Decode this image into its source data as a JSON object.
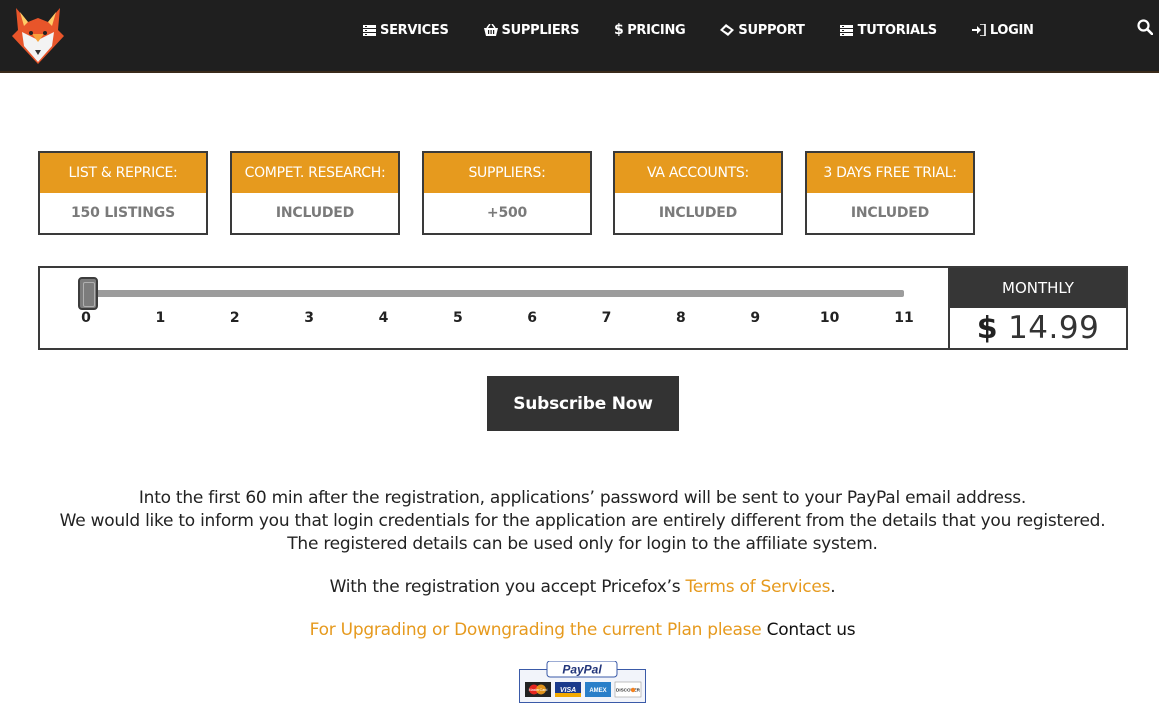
{
  "nav": {
    "items": [
      {
        "label": "SERVICES",
        "icon": "server-icon"
      },
      {
        "label": "SUPPLIERS",
        "icon": "basket-icon"
      },
      {
        "label": "PRICING",
        "icon": "dollar-icon"
      },
      {
        "label": "SUPPORT",
        "icon": "ticket-icon"
      },
      {
        "label": "TUTORIALS",
        "icon": "server-icon"
      },
      {
        "label": "LOGIN",
        "icon": "sign-in-icon"
      }
    ]
  },
  "features": [
    {
      "title": "LIST & REPRICE:",
      "value": "150 LISTINGS"
    },
    {
      "title": "COMPET. RESEARCH:",
      "value": "INCLUDED"
    },
    {
      "title": "SUPPLIERS:",
      "value": "+500"
    },
    {
      "title": "VA ACCOUNTS:",
      "value": "INCLUDED"
    },
    {
      "title": "3 DAYS FREE TRIAL:",
      "value": "INCLUDED"
    }
  ],
  "slider": {
    "ticks": [
      "0",
      "1",
      "2",
      "3",
      "4",
      "5",
      "6",
      "7",
      "8",
      "9",
      "10",
      "11"
    ],
    "value": 0,
    "min": 0,
    "max": 11
  },
  "price": {
    "period": "MONTHLY",
    "currency": "$",
    "amount": "14.99"
  },
  "subscribe_label": "Subscribe Now",
  "info": {
    "line1": "Into the first 60 min after the registration, applications’ password will be sent to your PayPal email address.",
    "line2": "We would like to inform you that login credentials for the application are entirely different from the details that you registered.",
    "line3": "The registered details can be used only for login to the affiliate system.",
    "terms_prefix": "With the registration you accept Pricefox’s ",
    "terms_link": "Terms of Services",
    "terms_suffix": ".",
    "upgrade_text": "For Upgrading or Downgrading the current Plan please ",
    "contact_link": "Contact us"
  },
  "paypal": {
    "brand": "PayPal",
    "cards": [
      "MasterCard",
      "VISA",
      "AMEX",
      "DISCOVER"
    ]
  },
  "colors": {
    "accent": "#e69a1e",
    "dark": "#1f1f1f"
  }
}
